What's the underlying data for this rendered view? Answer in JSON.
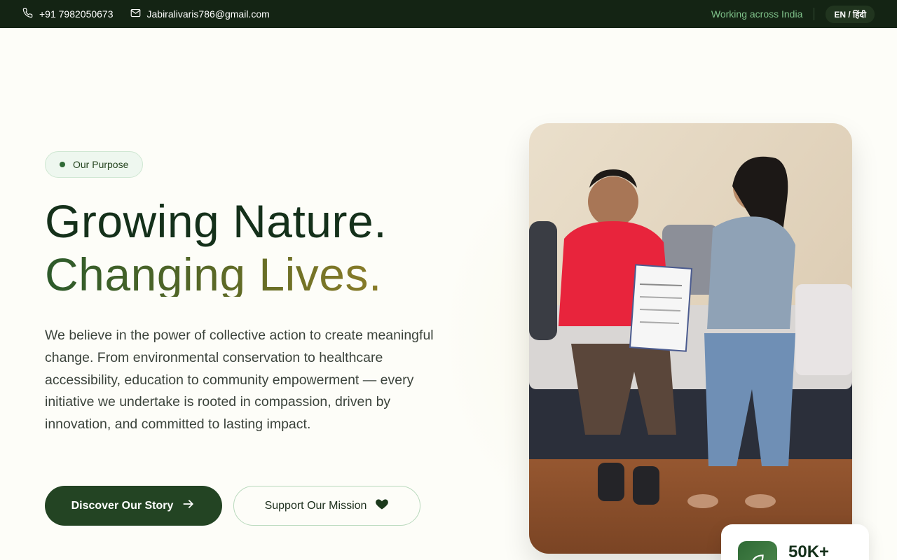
{
  "topbar": {
    "phone": "+91 7982050673",
    "email": "Jabiralivaris786@gmail.com",
    "location_text": "Working across India",
    "language_toggle": "EN / हिंदी"
  },
  "hero": {
    "badge": "Our Purpose",
    "headline_line1": "Growing Nature.",
    "headline_line2": "Changing Lives.",
    "description": "We believe in the power of collective action to create meaningful change. From environmental conservation to healthcare accessibility, education to community empowerment — every initiative we undertake is rooted in compassion, driven by innovation, and committed to lasting impact.",
    "primary_button": "Discover Our Story",
    "secondary_button": "Support Our Mission"
  },
  "stat": {
    "value": "50K+"
  },
  "icons": {
    "phone": "phone-icon",
    "email": "mail-icon",
    "arrow": "arrow-right-icon",
    "heart": "heart-icon",
    "stat": "leaf-icon"
  },
  "colors": {
    "topbar_bg": "#142414",
    "primary": "#234423",
    "accent_green": "#7fc28a",
    "gradient_end": "#8a7c28"
  }
}
